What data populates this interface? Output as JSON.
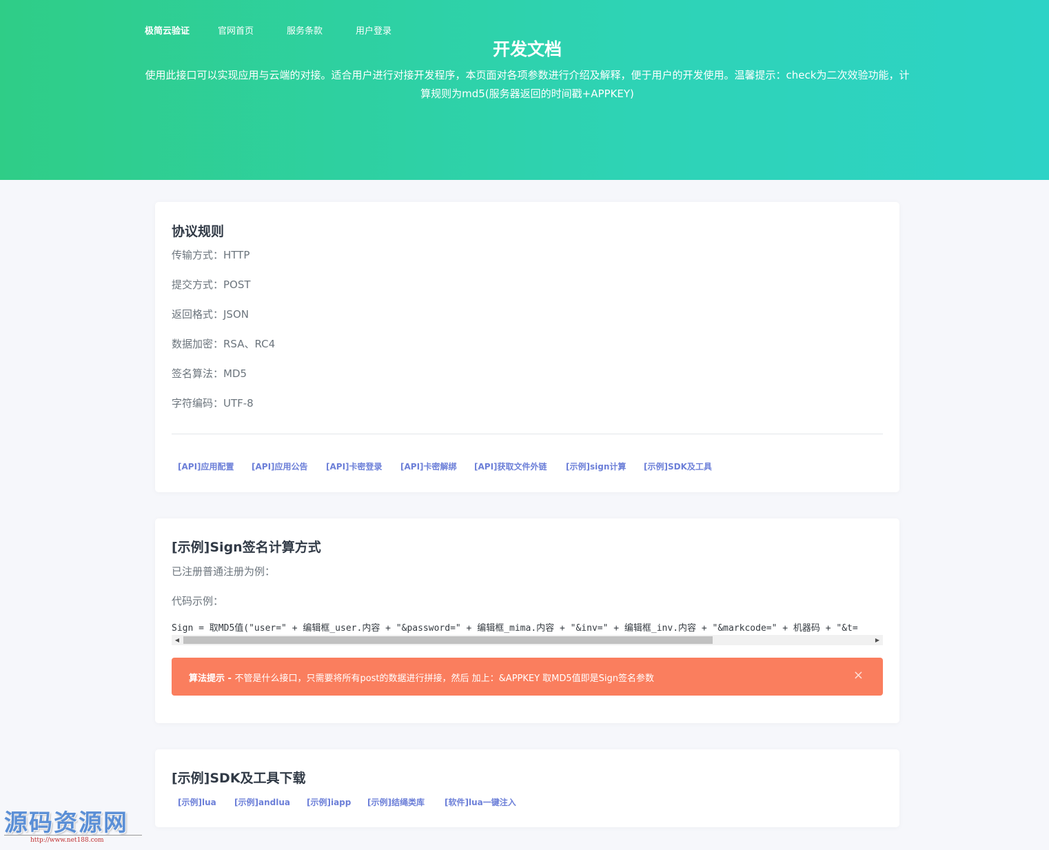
{
  "header": {
    "brand": "极简云验证",
    "nav": [
      "官网首页",
      "服务条款",
      "用户登录"
    ],
    "title": "开发文档",
    "subtitle": "使用此接口可以实现应用与云端的对接。适合用户进行对接开发程序，本页面对各项参数进行介绍及解释，便于用户的开发使用。温馨提示：check为二次效验功能，计算规则为md5(服务器返回的时间戳+APPKEY)"
  },
  "protocol": {
    "title": "协议规则",
    "rows": [
      "传输方式：HTTP",
      "提交方式：POST",
      "返回格式：JSON",
      "数据加密：RSA、RC4",
      "签名算法：MD5",
      "字符编码：UTF-8"
    ],
    "links": [
      "[API]应用配置",
      "[API]应用公告",
      "[API]卡密登录",
      "[API]卡密解绑",
      "[API]获取文件外链",
      "[示例]sign计算",
      "[示例]SDK及工具"
    ]
  },
  "sign": {
    "title": "[示例]Sign签名计算方式",
    "intro": "已注册普通注册为例：",
    "code_label": "代码示例：",
    "code": "Sign = 取MD5值(\"user=\" + 编辑框_user.内容 + \"&password=\" + 编辑框_mima.内容 + \"&inv=\" + 编辑框_inv.内容 + \"&markcode=\" + 机器码 + \"&t=",
    "alert_strong": "算法提示 - ",
    "alert_text": "不管是什么接口，只需要将所有post的数据进行拼接，然后 加上：&APPKEY 取MD5值即是Sign签名参数",
    "alert_close": "×",
    "scroll_fraction": 0.77
  },
  "sdk": {
    "title": "[示例]SDK及工具下载",
    "links": [
      "[示例]lua",
      "[示例]andlua",
      "[示例]iapp",
      "[示例]结绳类库",
      "[软件]lua一键注入"
    ]
  },
  "watermark": {
    "text": "源码资源网",
    "url": "http://www.net188.com"
  },
  "colors": {
    "hero_start": "#2fcd87",
    "hero_end": "#2dd3c6",
    "link": "#6c7fd8",
    "alert": "#fa7e5e"
  }
}
